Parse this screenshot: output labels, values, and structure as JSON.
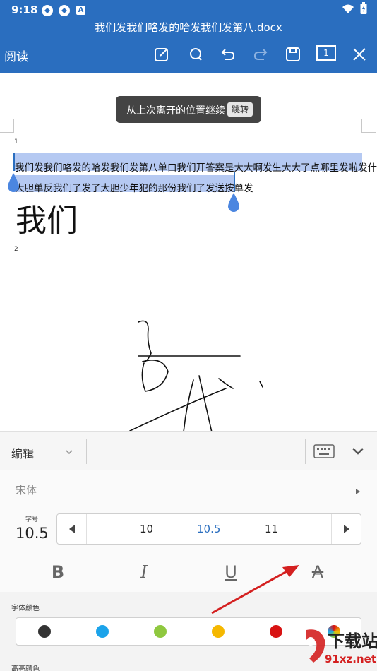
{
  "status": {
    "time": "9:18",
    "icon_a": "A"
  },
  "title": "我们发我们咯发的哈发我们发第八.docx",
  "toolbar": {
    "mode": "阅读",
    "page_number": "1"
  },
  "toast": {
    "message": "从上次离开的位置继续",
    "action": "跳转"
  },
  "document": {
    "page1_number": "1",
    "page2_number": "2",
    "line1": "我们发我们咯发的哈发我们发第八单口我们开答案是大大啊发生大大了点哪里发啦发什么",
    "line2": "大胆单反我们了发了大胆少年犯的那份我们了发送按单发",
    "large_text": "我们"
  },
  "panel": {
    "edit_label": "编辑",
    "font_name": "宋体",
    "size_caption": "字号",
    "size_value": "10.5",
    "size_options": [
      "10",
      "10.5",
      "11"
    ],
    "bold_label": "B",
    "italic_label": "I",
    "underline_label": "U",
    "strike_label": "A",
    "font_color_label": "字体颜色",
    "highlight_label": "高亮颜色"
  },
  "colors": {
    "toolbar_bg": "#2a6ebf",
    "selection": "#b5c9f2",
    "swatches": [
      "#333333",
      "#1ba3ea",
      "#8fc83f",
      "#f5b800",
      "#d81313"
    ],
    "arrow": "#d42020"
  },
  "watermark": {
    "brand_text": "下载站",
    "url_text": "91xz.net"
  }
}
